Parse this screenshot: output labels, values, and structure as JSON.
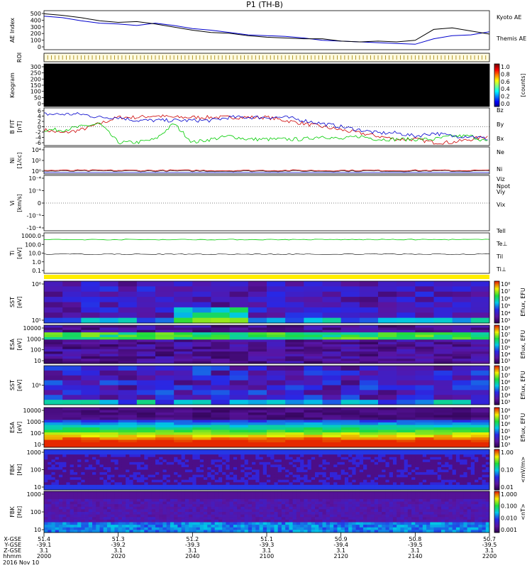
{
  "chart_data": {
    "type": "line",
    "title": "P1  (TH-B)",
    "x": {
      "tick_times": [
        "2000",
        "2020",
        "2040",
        "2100",
        "2120",
        "2140",
        "2200"
      ],
      "footer_rows": [
        {
          "label": "X-GSE",
          "values": [
            "51.4",
            "51.3",
            "51.2",
            "51.1",
            "50.9",
            "50.8",
            "50.7"
          ]
        },
        {
          "label": "Y-GSE",
          "values": [
            "-39.1",
            "-39.2",
            "-39.3",
            "-39.3",
            "-39.4",
            "-39.5",
            "-39.5"
          ]
        },
        {
          "label": "Z-GSE",
          "values": [
            "3.1",
            "3.1",
            "3.1",
            "3.1",
            "3.1",
            "3.1",
            "3.1"
          ]
        },
        {
          "label": "hhmm",
          "values": [
            "2000",
            "2020",
            "2040",
            "2100",
            "2120",
            "2140",
            "2200"
          ]
        }
      ],
      "date": "2016 Nov 10",
      "range_minutes": [
        0,
        120
      ]
    },
    "panels": [
      {
        "id": "ae",
        "type": "line",
        "ylabel": "AE Index",
        "yticks": [
          "500",
          "400",
          "300",
          "200",
          "100",
          "0"
        ],
        "ylim": [
          0,
          500
        ],
        "series": [
          {
            "name": "Kyoto AE",
            "color": "#0000cc",
            "t": [
              0,
              5,
              10,
              15,
              20,
              25,
              30,
              35,
              40,
              45,
              50,
              55,
              60,
              65,
              70,
              75,
              80,
              85,
              90,
              95,
              100,
              105,
              110,
              115,
              120
            ],
            "y": [
              430,
              410,
              370,
              340,
              330,
              310,
              340,
              310,
              270,
              250,
              220,
              190,
              180,
              170,
              150,
              120,
              110,
              100,
              90,
              80,
              70,
              140,
              180,
              190,
              230
            ]
          },
          {
            "name": "Themis AE",
            "color": "#000000",
            "t": [
              0,
              5,
              10,
              15,
              20,
              25,
              30,
              35,
              40,
              45,
              50,
              55,
              60,
              65,
              70,
              75,
              80,
              85,
              90,
              95,
              100,
              105,
              110,
              115,
              120
            ],
            "y": [
              460,
              440,
              410,
              370,
              350,
              360,
              330,
              290,
              250,
              220,
              210,
              180,
              160,
              150,
              140,
              140,
              110,
              100,
              110,
              100,
              120,
              260,
              280,
              240,
              200
            ]
          }
        ]
      },
      {
        "id": "roi",
        "type": "ticks",
        "ylabel": "ROI",
        "ticks_minutes": [
          0,
          1,
          2,
          3,
          4,
          5,
          6,
          7,
          8,
          9,
          10,
          11,
          12,
          13,
          14,
          15,
          16,
          17,
          18,
          19,
          20,
          21,
          22,
          23,
          24,
          25,
          26,
          27,
          28,
          29,
          30,
          31,
          32,
          33,
          34,
          35,
          36,
          37,
          38,
          39,
          40,
          41,
          42,
          43,
          44,
          45,
          46,
          47,
          48,
          49,
          50,
          51,
          52,
          53,
          54,
          55,
          56,
          57,
          58,
          59,
          60,
          61,
          62,
          63,
          64,
          65,
          66,
          67,
          68,
          69,
          70,
          71,
          72,
          73,
          74,
          75,
          76,
          77,
          78,
          79,
          80,
          81,
          82,
          83,
          84,
          85,
          86,
          87,
          88,
          89,
          90,
          91,
          92,
          93,
          94,
          95,
          96,
          97,
          98,
          99,
          100,
          101,
          102,
          103,
          104,
          105,
          106,
          107,
          108,
          109,
          110,
          111,
          112,
          113,
          114,
          115,
          116,
          117,
          118,
          119,
          120
        ]
      },
      {
        "id": "keo",
        "type": "heatmap",
        "ylabel": "Keogram",
        "yticks": [
          "300",
          "250",
          "200",
          "150",
          "100",
          "50",
          "0"
        ],
        "colorbar": {
          "ticks": [
            "1.0",
            "0.8",
            "0.6",
            "0.4",
            "0.2",
            "0.0"
          ],
          "label": "[counts]"
        }
      },
      {
        "id": "bfit",
        "type": "line",
        "ylabel": "B FIT",
        "ylabel2": "[nT]",
        "yticks": [
          "6",
          "4",
          "2",
          "0",
          "-2",
          "-4",
          "-6"
        ],
        "ylim": [
          -6,
          6
        ],
        "series": [
          {
            "name": "Bz",
            "color": "#cc0000",
            "t": [
              0,
              5,
              10,
              15,
              20,
              25,
              30,
              35,
              40,
              45,
              50,
              55,
              60,
              65,
              70,
              75,
              80,
              85,
              90,
              95,
              100,
              105,
              110,
              115,
              120
            ],
            "y": [
              -1,
              -2,
              -1,
              1,
              3,
              3,
              3.5,
              3,
              3,
              3,
              3,
              3,
              3,
              2,
              1,
              0,
              -1,
              -2,
              -3,
              -4,
              -4,
              -5,
              -5,
              -4,
              -3
            ]
          },
          {
            "name": "By",
            "color": "#00cc00",
            "t": [
              0,
              5,
              10,
              15,
              20,
              25,
              30,
              35,
              40,
              45,
              50,
              55,
              60,
              65,
              70,
              75,
              80,
              85,
              90,
              95,
              100,
              105,
              110,
              115,
              120
            ],
            "y": [
              -1,
              -1,
              0,
              1,
              -5,
              -5,
              -4,
              1,
              -5,
              -4,
              -3,
              -4,
              -4,
              -4,
              -4,
              -3,
              -4,
              -3,
              -4,
              -4,
              -4,
              -4,
              -3,
              -3,
              -5
            ]
          },
          {
            "name": "Bx",
            "color": "#0000cc",
            "t": [
              0,
              5,
              10,
              15,
              20,
              25,
              30,
              35,
              40,
              45,
              50,
              55,
              60,
              65,
              70,
              75,
              80,
              85,
              90,
              95,
              100,
              105,
              110,
              115,
              120
            ],
            "y": [
              4,
              4,
              4,
              3,
              3,
              2,
              2,
              2,
              2,
              2,
              3,
              3,
              3,
              3,
              2,
              1,
              0,
              -1,
              -2,
              -2,
              -3,
              -2,
              -3,
              -3,
              -4
            ]
          }
        ]
      },
      {
        "id": "ni",
        "type": "line",
        "ylabel": "Ni",
        "ylabel2": "[1/cc]",
        "yticks": [
          "10⁴",
          "10²",
          "10⁰"
        ],
        "series": [
          {
            "name": "Ne",
            "color": "#cc0000"
          },
          {
            "name": "Ni",
            "color": "#000000"
          },
          {
            "name": "Npot",
            "color": "#0000cc"
          }
        ]
      },
      {
        "id": "vi",
        "type": "line",
        "ylabel": "Vi",
        "ylabel2": "[km/s]",
        "yticks": [
          "10⁻⁴",
          "10⁻⁵",
          "0",
          "-10⁻⁵",
          "-10⁻⁴"
        ],
        "series": [
          {
            "name": "Viz",
            "color": "#cc0000"
          },
          {
            "name": "Viy",
            "color": "#00cc00"
          },
          {
            "name": "Vix",
            "color": "#0000cc"
          }
        ]
      },
      {
        "id": "ti",
        "type": "line",
        "ylabel": "Ti",
        "ylabel2": "[eV]",
        "yticks": [
          "1000.0",
          "100.0",
          "10.0",
          "1.0",
          "0.1"
        ],
        "series": [
          {
            "name": "Tell",
            "color": "#000000"
          },
          {
            "name": "Te⊥",
            "color": "#cc0000"
          },
          {
            "name": "Til",
            "color": "#00cc00"
          },
          {
            "name": "Ti⊥",
            "color": "#0000cc"
          }
        ]
      },
      {
        "id": "sst_e",
        "type": "heatmap",
        "ylabel": "SST",
        "ylabel2": "[eV]",
        "yticks": [
          "10⁶",
          "10⁵"
        ],
        "colorbar": {
          "ticks": [
            "10⁸",
            "10⁷",
            "10⁶",
            "10⁵",
            "10⁴",
            "10³"
          ],
          "label": "Eflux, EFU"
        }
      },
      {
        "id": "esa_e",
        "type": "heatmap",
        "ylabel": "ESA",
        "ylabel2": "[eV]",
        "yticks": [
          "10000",
          "1000",
          "100",
          "10"
        ],
        "colorbar": {
          "ticks": [
            "10⁸",
            "10⁷",
            "10⁶",
            "10⁵",
            "10⁴",
            "10³"
          ],
          "label": "Eflux, EFU"
        }
      },
      {
        "id": "sst_i",
        "type": "heatmap",
        "ylabel": "SST",
        "ylabel2": "[eV]",
        "yticks": [
          "10⁵"
        ],
        "colorbar": {
          "ticks": [
            "10⁸",
            "10⁷",
            "10⁶",
            "10⁵",
            "10⁴",
            "10³"
          ],
          "label": "Eflux, EFU"
        }
      },
      {
        "id": "esa_i",
        "type": "heatmap",
        "ylabel": "ESA",
        "ylabel2": "[eV]",
        "yticks": [
          "10000",
          "1000",
          "100",
          "10"
        ],
        "colorbar": {
          "ticks": [
            "10⁸",
            "10⁷",
            "10⁶",
            "10⁵",
            "10⁴",
            "10³"
          ],
          "label": "Eflux, EFU"
        }
      },
      {
        "id": "fbk_e",
        "type": "heatmap",
        "ylabel": "FBK",
        "ylabel2": "[Hz]",
        "yticks": [
          "1000",
          "100",
          "10"
        ],
        "colorbar": {
          "ticks": [
            "1.00",
            "0.10",
            "0.01"
          ],
          "label": "<mV/m>"
        }
      },
      {
        "id": "fbk_b",
        "type": "heatmap",
        "ylabel": "FBK",
        "ylabel2": "[Hz]",
        "yticks": [
          "1000",
          "100",
          "10"
        ],
        "colorbar": {
          "ticks": [
            "1.000",
            "0.100",
            "0.010",
            "0.001"
          ],
          "label": "<nT>"
        }
      }
    ]
  }
}
